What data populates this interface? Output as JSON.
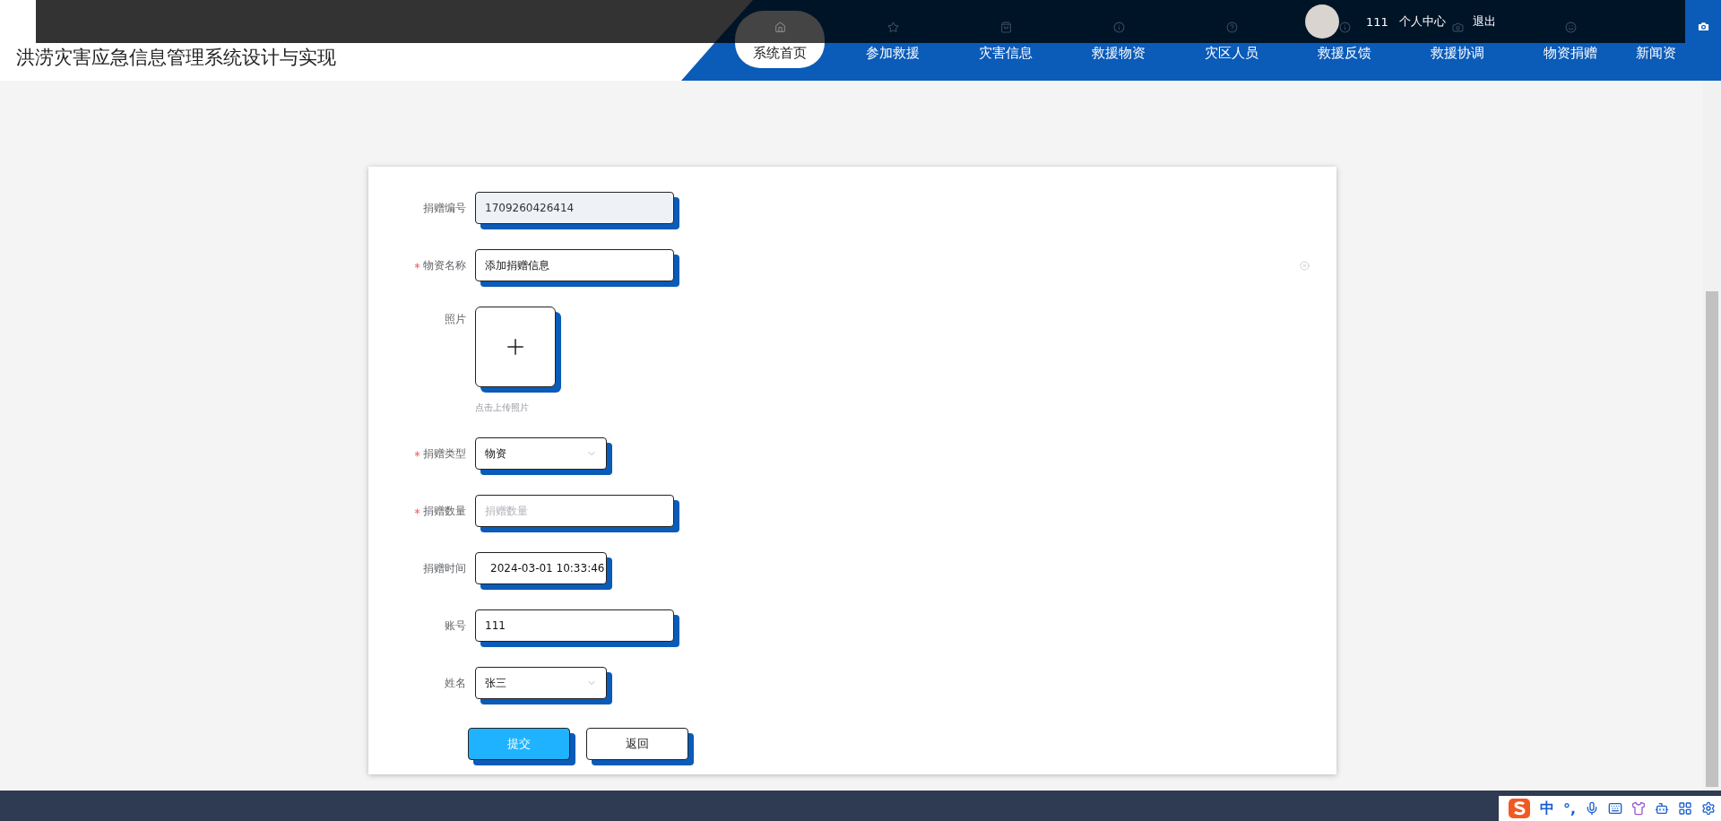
{
  "header": {
    "title": "洪涝灾害应急信息管理系统设计与实现",
    "nav": [
      {
        "label": "系统首页",
        "selected": true
      },
      {
        "label": "参加救援",
        "selected": false
      },
      {
        "label": "灾害信息",
        "selected": false
      },
      {
        "label": "救援物资",
        "selected": false
      },
      {
        "label": "灾区人员",
        "selected": false
      },
      {
        "label": "救援反馈",
        "selected": false
      },
      {
        "label": "救援协调",
        "selected": false
      },
      {
        "label": "物资捐赠",
        "selected": false
      },
      {
        "label": "新闻资",
        "selected": false
      }
    ],
    "user": {
      "name": "111",
      "links": [
        "个人中心",
        "退出"
      ]
    }
  },
  "form": {
    "fields": [
      {
        "kind": "text",
        "label": "捐赠编号",
        "required": false,
        "value": "1709260426414",
        "disabled": true
      },
      {
        "kind": "text",
        "label": "物资名称",
        "required": true,
        "value": "添加捐赠信息",
        "clearable": true,
        "disabled": false
      },
      {
        "kind": "upload",
        "label": "照片",
        "required": false,
        "hint": "点击上传照片"
      },
      {
        "kind": "select",
        "label": "捐赠类型",
        "required": true,
        "value": "物资"
      },
      {
        "kind": "text",
        "label": "捐赠数量",
        "required": true,
        "placeholder": "捐赠数量",
        "disabled": false
      },
      {
        "kind": "datetime",
        "label": "捐赠时间",
        "required": false,
        "value": "2024-03-01 10:33:46"
      },
      {
        "kind": "text",
        "label": "账号",
        "required": false,
        "value": "111",
        "disabled": false
      },
      {
        "kind": "select",
        "label": "姓名",
        "required": false,
        "value": "张三"
      }
    ],
    "buttons": [
      {
        "label": "提交",
        "kind": "primary"
      },
      {
        "label": "返回",
        "kind": "default"
      }
    ]
  },
  "ime": {
    "mode": "中",
    "punct": "°,"
  }
}
